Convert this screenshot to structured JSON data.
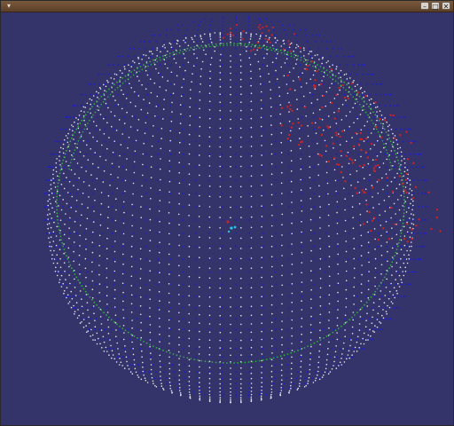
{
  "window": {
    "title": "",
    "menu_glyph": "▾",
    "controls": {
      "minimize": "–",
      "maximize": "□",
      "close": "✕"
    }
  },
  "scene": {
    "background": "#34346a",
    "colors": {
      "outer_shell": "#1e1ecc",
      "front_grid": "#e6e6f0",
      "equator_band": "#2fae3a",
      "red_points": "#cc2222",
      "center_marker": "#20c8e8"
    }
  }
}
